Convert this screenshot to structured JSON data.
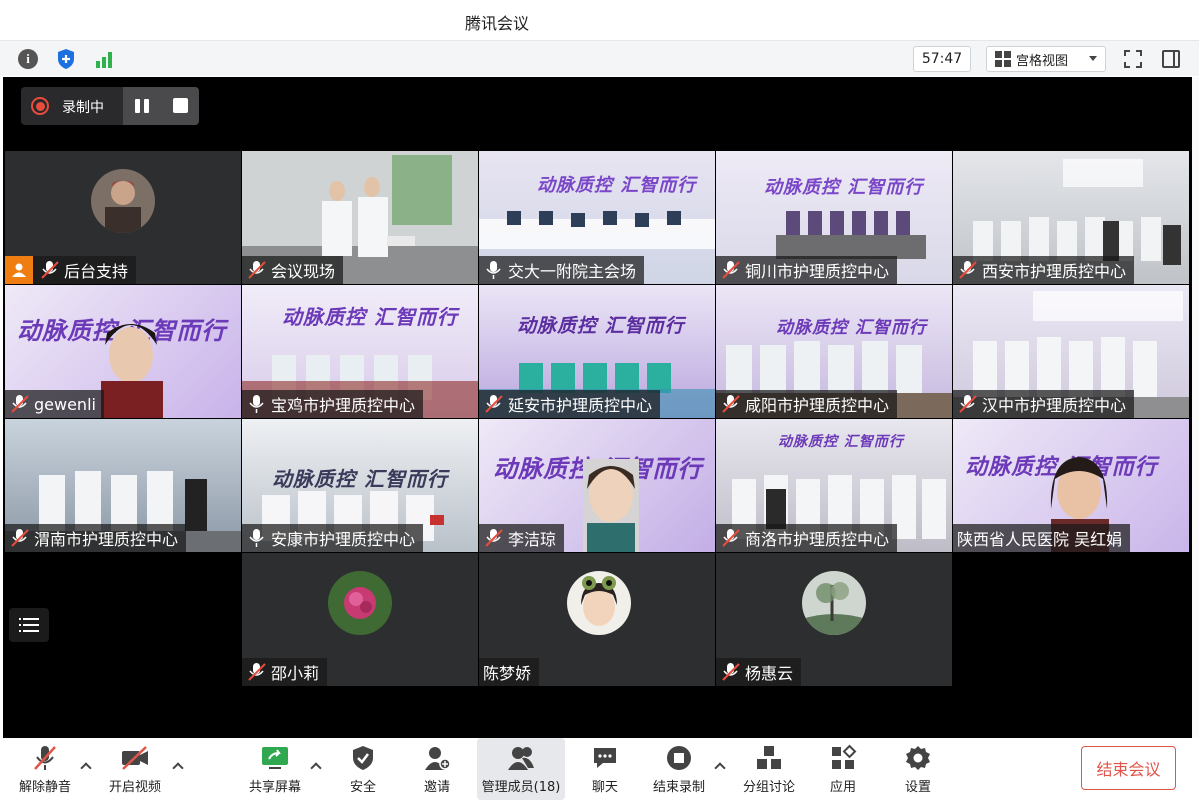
{
  "window": {
    "title": "腾讯会议"
  },
  "toolbar": {
    "timer": "57:47",
    "view_mode": "宫格视图",
    "icons": [
      "info-icon",
      "shield-icon",
      "signal-icon",
      "fullscreen-icon",
      "sidebar-icon"
    ]
  },
  "recording": {
    "label": "录制中"
  },
  "participants": [
    {
      "name": "后台支持",
      "mic": "muted",
      "host": true,
      "kind": "avatar"
    },
    {
      "name": "会议现场",
      "mic": "muted",
      "kind": "video-room"
    },
    {
      "name": "交大一附院主会场",
      "mic": "on",
      "kind": "video-banner"
    },
    {
      "name": "铜川市护理质控中心",
      "mic": "muted",
      "kind": "video-banner"
    },
    {
      "name": "西安市护理质控中心",
      "mic": "muted",
      "kind": "video-room"
    },
    {
      "name": "gewenli",
      "mic": "muted",
      "kind": "video-person"
    },
    {
      "name": "宝鸡市护理质控中心",
      "mic": "on",
      "kind": "video-banner"
    },
    {
      "name": "延安市护理质控中心",
      "mic": "muted",
      "kind": "video-banner"
    },
    {
      "name": "咸阳市护理质控中心",
      "mic": "muted",
      "kind": "video-banner"
    },
    {
      "name": "汉中市护理质控中心",
      "mic": "muted",
      "kind": "video-banner"
    },
    {
      "name": "渭南市护理质控中心",
      "mic": "muted",
      "kind": "video-room"
    },
    {
      "name": "安康市护理质控中心",
      "mic": "on",
      "kind": "video-banner"
    },
    {
      "name": "李洁琼",
      "mic": "muted",
      "kind": "video-person"
    },
    {
      "name": "商洛市护理质控中心",
      "mic": "muted",
      "kind": "video-banner"
    },
    {
      "name": "陕西省人民医院 吴红娟",
      "mic": "none",
      "kind": "video-person"
    },
    {
      "name": "邵小莉",
      "mic": "muted",
      "kind": "avatar"
    },
    {
      "name": "陈梦娇",
      "mic": "none",
      "kind": "avatar"
    },
    {
      "name": "杨惠云",
      "mic": "muted",
      "kind": "avatar"
    }
  ],
  "banner": {
    "text": "动脉质控 汇智而行",
    "logo": "BD"
  },
  "controls": {
    "unmute": "解除静音",
    "start_video": "开启视频",
    "share_screen": "共享屏幕",
    "security": "安全",
    "invite": "邀请",
    "manage_members": "管理成员(18)",
    "chat": "聊天",
    "end_recording": "结束录制",
    "breakout": "分组讨论",
    "apps": "应用",
    "settings": "设置",
    "end_meeting": "结束会议"
  },
  "colors": {
    "accent_red": "#e1554a",
    "banner_purple": "#8a56d6",
    "host_orange": "#f07d12",
    "stage_bg": "#000000"
  }
}
